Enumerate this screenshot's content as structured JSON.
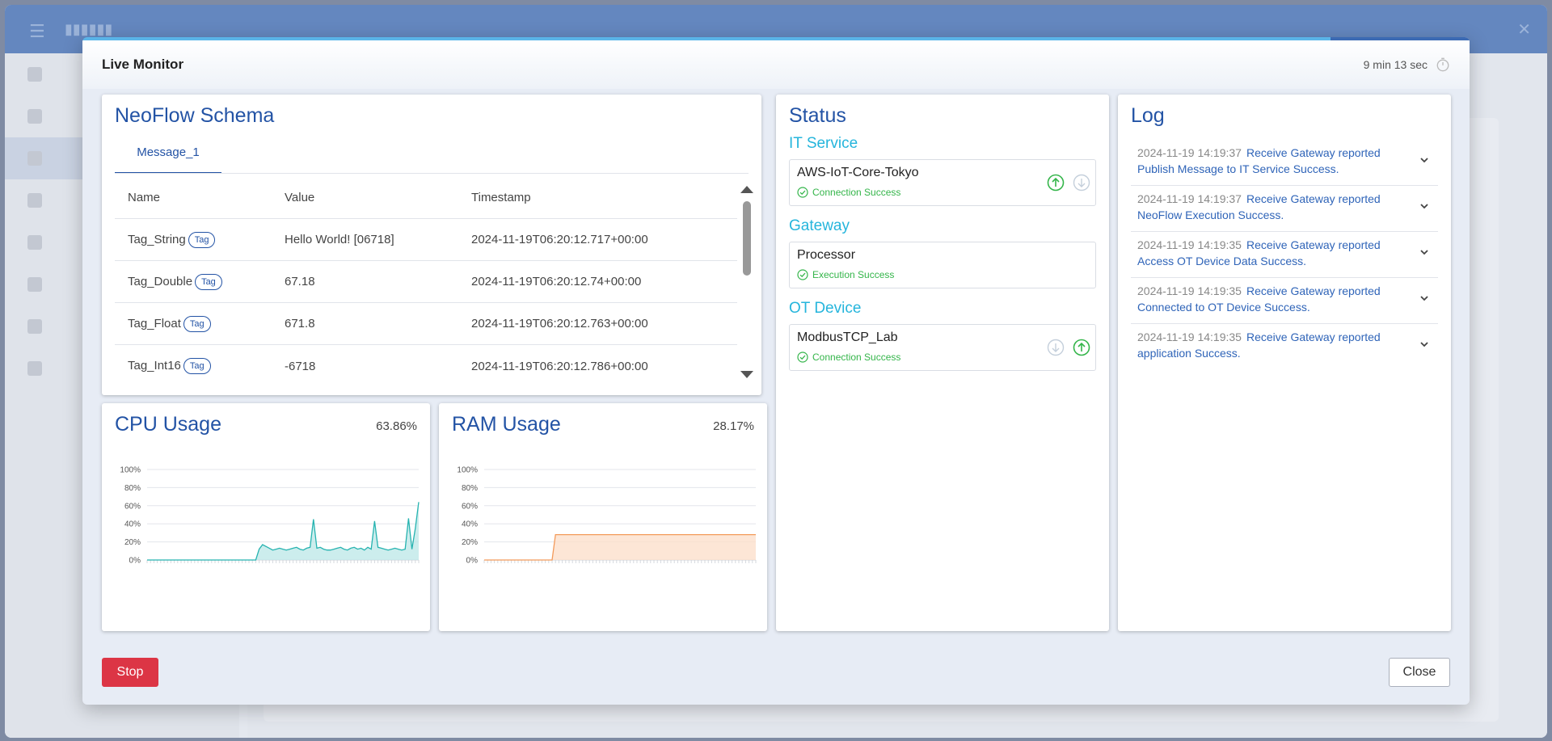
{
  "modal": {
    "title": "Live Monitor",
    "timer": "9 min 13 sec",
    "progress_fraction": 0.9
  },
  "schema": {
    "title": "NeoFlow Schema",
    "tabs": [
      "Message_1"
    ],
    "columns": [
      "Name",
      "Value",
      "Timestamp"
    ],
    "rows": [
      {
        "name": "Tag_String",
        "tag": "Tag",
        "value": "Hello World! [06718]",
        "timestamp": "2024-11-19T06:20:12.717+00:00"
      },
      {
        "name": "Tag_Double",
        "tag": "Tag",
        "value": "67.18",
        "timestamp": "2024-11-19T06:20:12.74+00:00"
      },
      {
        "name": "Tag_Float",
        "tag": "Tag",
        "value": "671.8",
        "timestamp": "2024-11-19T06:20:12.763+00:00"
      },
      {
        "name": "Tag_Int16",
        "tag": "Tag",
        "value": "-6718",
        "timestamp": "2024-11-19T06:20:12.786+00:00"
      }
    ]
  },
  "cpu": {
    "title": "CPU Usage",
    "value": "63.86%",
    "color": "#26b3b0",
    "fill": "#bfe9e8"
  },
  "ram": {
    "title": "RAM Usage",
    "value": "28.17%",
    "color": "#f39a5a",
    "fill": "#fde0cc"
  },
  "chart_data": [
    {
      "type": "area",
      "title": "CPU Usage",
      "ylim": [
        0,
        100
      ],
      "yticks": [
        "100%",
        "80%",
        "60%",
        "40%",
        "20%",
        "0%"
      ],
      "series": [
        {
          "values": [
            0,
            0,
            0,
            0,
            0,
            0,
            0,
            0,
            0,
            0,
            0,
            0,
            0,
            0,
            0,
            0,
            0,
            0,
            0,
            0,
            0,
            0,
            0,
            0,
            0,
            0,
            0,
            0,
            0,
            0,
            0,
            0,
            0,
            12,
            17,
            15,
            13,
            11,
            12,
            13,
            12,
            11,
            12,
            13,
            14,
            12,
            11,
            13,
            14,
            45,
            13,
            14,
            12,
            11,
            11,
            12,
            13,
            14,
            12,
            11,
            13,
            14,
            12,
            13,
            11,
            14,
            12,
            43,
            14,
            13,
            12,
            11,
            12,
            13,
            12,
            11,
            12,
            46,
            12,
            35,
            64
          ]
        }
      ]
    },
    {
      "type": "area",
      "title": "RAM Usage",
      "ylim": [
        0,
        100
      ],
      "yticks": [
        "100%",
        "80%",
        "60%",
        "40%",
        "20%",
        "0%"
      ],
      "series": [
        {
          "values": [
            0,
            0,
            0,
            0,
            0,
            0,
            0,
            0,
            0,
            0,
            0,
            0,
            0,
            0,
            0,
            0,
            0,
            0,
            0,
            0,
            0,
            28,
            28,
            28,
            28,
            28,
            28,
            28,
            28,
            28,
            28,
            28,
            28,
            28,
            28,
            28,
            28,
            28,
            28,
            28,
            28,
            28,
            28,
            28,
            28,
            28,
            28,
            28,
            28,
            28,
            28,
            28,
            28,
            28,
            28,
            28,
            28,
            28,
            28,
            28,
            28,
            28,
            28,
            28,
            28,
            28,
            28,
            28,
            28,
            28,
            28,
            28,
            28,
            28,
            28,
            28,
            28,
            28,
            28,
            28,
            28
          ]
        }
      ]
    }
  ],
  "status": {
    "title": "Status",
    "sections": [
      {
        "label": "IT Service",
        "name": "AWS-IoT-Core-Tokyo",
        "state": "Connection Success"
      },
      {
        "label": "Gateway",
        "name": "Processor",
        "state": "Execution Success"
      },
      {
        "label": "OT Device",
        "name": "ModbusTCP_Lab",
        "state": "Connection Success"
      }
    ]
  },
  "log": {
    "title": "Log",
    "items": [
      {
        "time": "2024-11-19 14:19:37",
        "message": "Receive Gateway reported Publish Message to IT Service Success."
      },
      {
        "time": "2024-11-19 14:19:37",
        "message": "Receive Gateway reported NeoFlow Execution Success."
      },
      {
        "time": "2024-11-19 14:19:35",
        "message": "Receive Gateway reported Access OT Device Data Success."
      },
      {
        "time": "2024-11-19 14:19:35",
        "message": "Receive Gateway reported Connected to OT Device Success."
      },
      {
        "time": "2024-11-19 14:19:35",
        "message": "Receive Gateway reported application Success."
      }
    ]
  },
  "footer": {
    "stop_label": "Stop",
    "close_label": "Close"
  }
}
